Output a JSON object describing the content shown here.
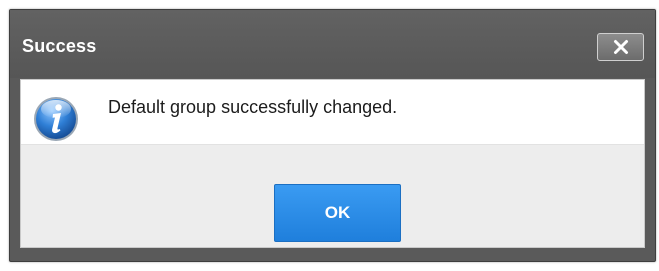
{
  "dialog": {
    "title": "Success",
    "close_icon": "close-icon",
    "message": "Default group successfully changed.",
    "message_icon": "info-icon",
    "ok_label": "OK"
  },
  "colors": {
    "titlebar": "#5a5a5a",
    "button_accent": "#2a8ce8",
    "button_area": "#ededed"
  }
}
